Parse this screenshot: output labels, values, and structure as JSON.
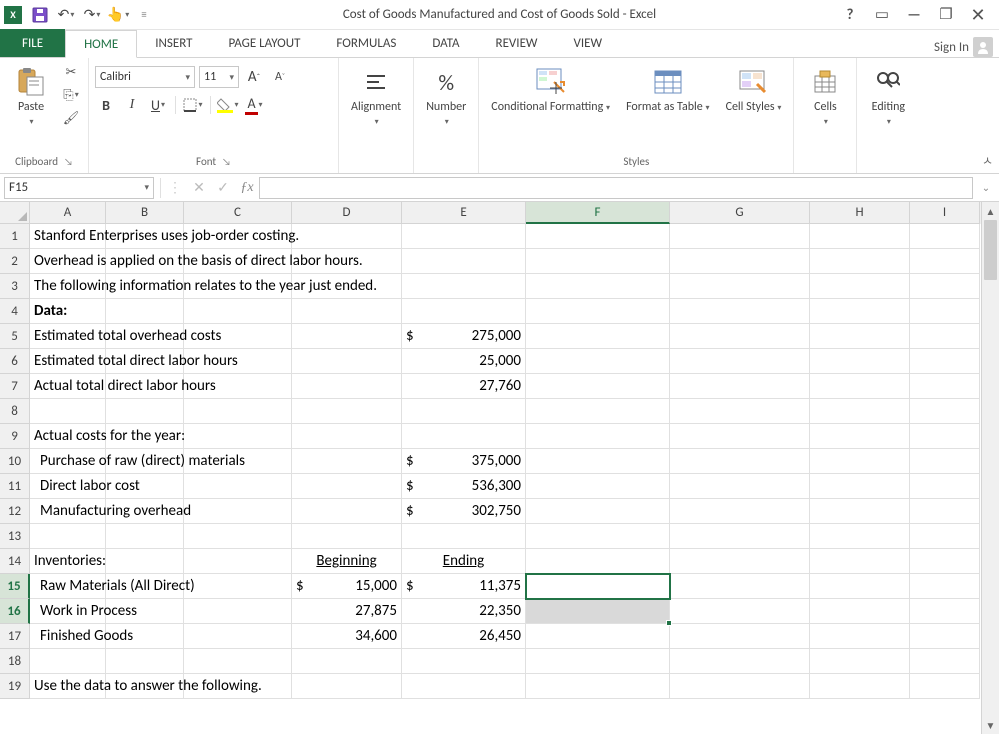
{
  "title": "Cost of Goods Manufactured and Cost of Goods Sold - Excel",
  "signin": "Sign In",
  "tabs": {
    "file": "FILE",
    "home": "HOME",
    "insert": "INSERT",
    "pagelayout": "PAGE LAYOUT",
    "formulas": "FORMULAS",
    "data": "DATA",
    "review": "REVIEW",
    "view": "VIEW"
  },
  "ribbon": {
    "clipboard": {
      "paste": "Paste",
      "label": "Clipboard"
    },
    "font": {
      "name": "Calibri",
      "size": "11",
      "label": "Font"
    },
    "alignment": {
      "label": "Alignment"
    },
    "number": {
      "label": "Number",
      "percent": "%"
    },
    "styles": {
      "cond": "Conditional Formatting",
      "table": "Format as Table",
      "cell": "Cell Styles",
      "label": "Styles"
    },
    "cells": {
      "label": "Cells"
    },
    "editing": {
      "label": "Editing"
    }
  },
  "namebox": "F15",
  "formula": "",
  "cols": [
    "A",
    "B",
    "C",
    "D",
    "E",
    "F",
    "G",
    "H",
    "I"
  ],
  "activeCol": "F",
  "activeRows": [
    15,
    16
  ],
  "sheet": {
    "r1": "Stanford Enterprises uses job-order costing.",
    "r2": "Overhead is applied on the basis of direct labor hours.",
    "r3": "The following information relates to the year just ended.",
    "r4": "Data:",
    "r5a": "Estimated total overhead costs",
    "r5d": "$",
    "r5e": "275,000",
    "r6a": "Estimated total direct labor hours",
    "r6e": "25,000",
    "r7a": "Actual total direct labor hours",
    "r7e": "27,760",
    "r9a": "Actual costs for the year:",
    "r10a": "Purchase of raw (direct) materials",
    "r10d": "$",
    "r10e": "375,000",
    "r11a": "Direct labor cost",
    "r11d": "$",
    "r11e": "536,300",
    "r12a": "Manufacturing overhead",
    "r12d": "$",
    "r12e": "302,750",
    "r14a": "Inventories:",
    "r14d": "Beginning",
    "r14e": "Ending",
    "r15a": "Raw Materials (All Direct)",
    "r15d_s": "$",
    "r15d_v": "15,000",
    "r15e_s": "$",
    "r15e_v": "11,375",
    "r16a": "Work in Process",
    "r16d": "27,875",
    "r16e": "22,350",
    "r17a": "Finished Goods",
    "r17d": "34,600",
    "r17e": "26,450",
    "r19a": "Use the data to answer the following."
  }
}
